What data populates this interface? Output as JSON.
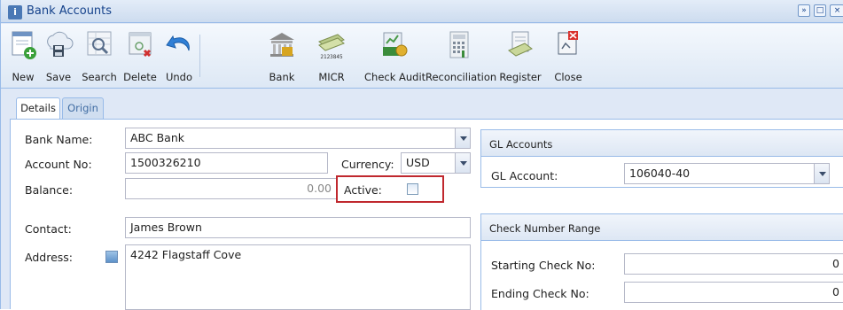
{
  "window": {
    "title": "Bank Accounts"
  },
  "toolbar": {
    "buttons": [
      {
        "label": "New",
        "icon": "new-document-icon"
      },
      {
        "label": "Save",
        "icon": "cloud-save-icon"
      },
      {
        "label": "Search",
        "icon": "search-icon"
      },
      {
        "label": "Delete",
        "icon": "delete-icon"
      },
      {
        "label": "Undo",
        "icon": "undo-icon"
      },
      {
        "label": "Bank",
        "icon": "bank-icon"
      },
      {
        "label": "MICR",
        "icon": "micr-check-icon",
        "icon_text": "2123845"
      },
      {
        "label": "Check Audit",
        "icon": "check-audit-icon"
      },
      {
        "label": "Reconciliation",
        "icon": "reconciliation-icon"
      },
      {
        "label": "Register",
        "icon": "register-icon"
      },
      {
        "label": "Close",
        "icon": "close-icon"
      }
    ]
  },
  "tabs": [
    {
      "label": "Details",
      "active": true
    },
    {
      "label": "Origin",
      "active": false
    }
  ],
  "form": {
    "bank_name_label": "Bank Name:",
    "bank_name": "ABC Bank",
    "account_no_label": "Account No:",
    "account_no": "1500326210",
    "currency_label": "Currency:",
    "currency": "USD",
    "balance_label": "Balance:",
    "balance": "0.00",
    "active_label": "Active:",
    "active_checked": false,
    "contact_label": "Contact:",
    "contact": "James Brown",
    "address_label": "Address:",
    "address": "4242 Flagstaff Cove"
  },
  "gl_panel": {
    "title": "GL Accounts",
    "gl_account_label": "GL Account:",
    "gl_account": "106040-40"
  },
  "check_panel": {
    "title": "Check Number Range",
    "starting_label": "Starting Check No:",
    "starting_value": "0",
    "ending_label": "Ending Check No:",
    "ending_value": "0"
  },
  "colors": {
    "frame_border": "#99bbe8",
    "title_text": "#15428b",
    "highlight": "#c0282e"
  }
}
